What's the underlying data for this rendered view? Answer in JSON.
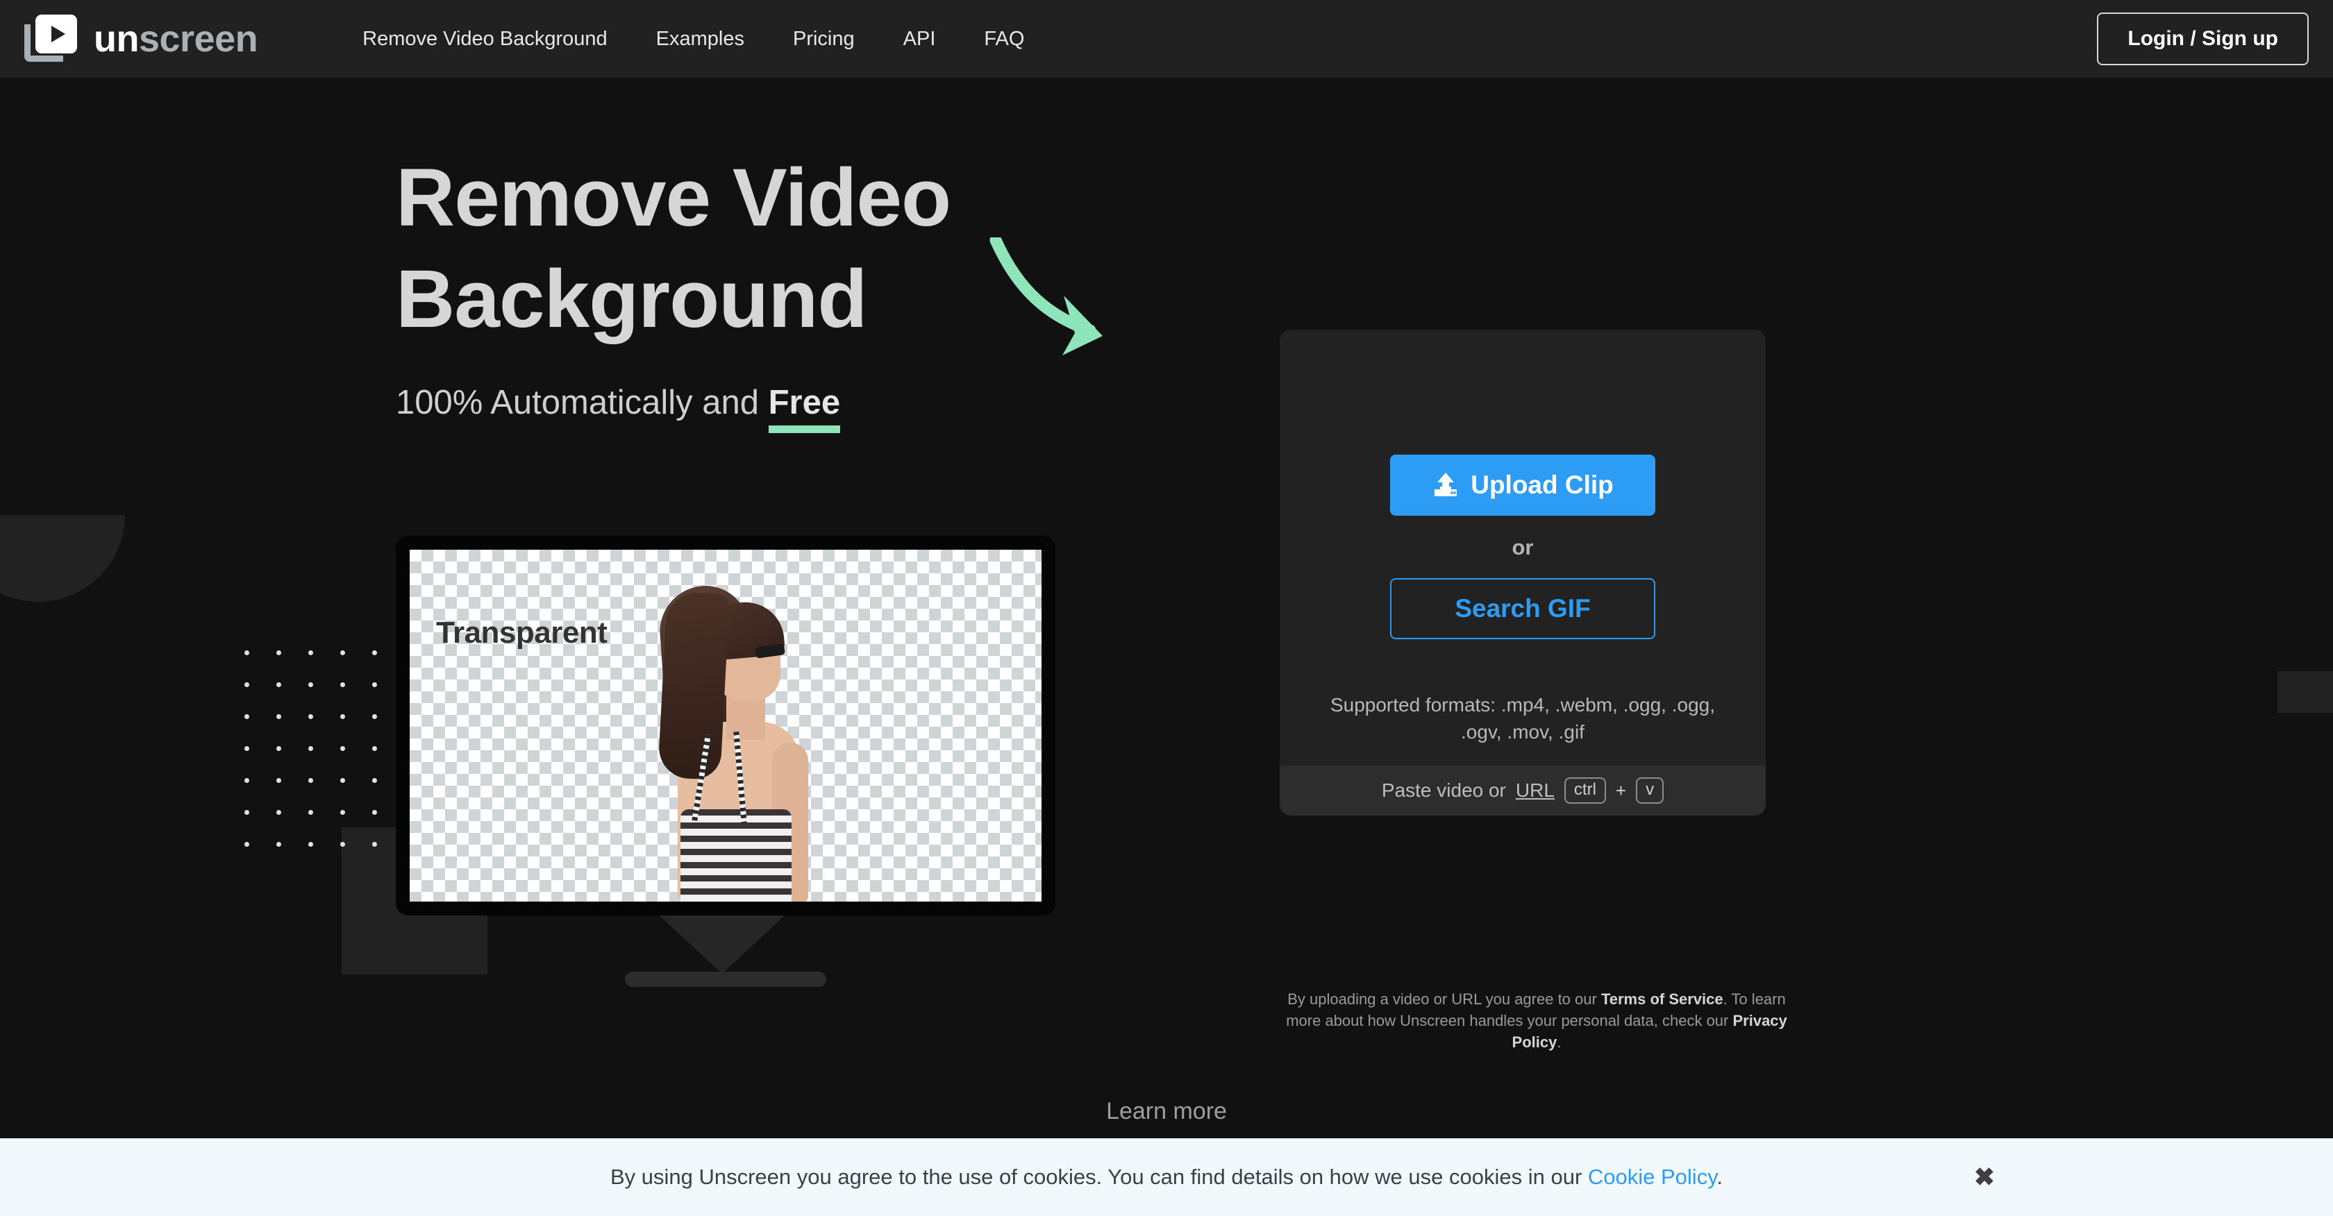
{
  "header": {
    "logo": {
      "un": "un",
      "screen": "screen",
      "icon": "video-stack-play-icon"
    },
    "nav": [
      {
        "label": "Remove Video Background"
      },
      {
        "label": "Examples"
      },
      {
        "label": "Pricing"
      },
      {
        "label": "API"
      },
      {
        "label": "FAQ"
      }
    ],
    "login_label": "Login / Sign up"
  },
  "hero": {
    "title_line1": "Remove Video",
    "title_line2": "Background",
    "subtitle_prefix": "100% Automatically and ",
    "subtitle_highlight": "Free",
    "arrow_color": "#8ee5ba",
    "underline_color": "#8ee5ba"
  },
  "preview": {
    "screen_label": "Transparent",
    "checker_light": "#ffffff",
    "checker_dark": "#cfd4d6"
  },
  "upload_card": {
    "upload_label": "Upload Clip",
    "upload_icon": "upload-icon",
    "or_label": "or",
    "search_gif_label": "Search GIF",
    "formats_text": "Supported formats: .mp4, .webm, .ogg, .ogg, .ogv, .mov, .gif",
    "paste_prefix": "Paste video or ",
    "paste_url_label": "URL",
    "key_ctrl": "ctrl",
    "key_plus": "+",
    "key_v": "v",
    "accent_color": "#2d9cf5"
  },
  "disclaimer": {
    "part1": "By uploading a video or URL you agree to our ",
    "terms_label": "Terms of Service",
    "part2": ". To learn more about how Unscreen handles your personal data, check our ",
    "privacy_label": "Privacy Policy",
    "part3": "."
  },
  "learn_more": {
    "label": "Learn more",
    "icon": "chevron-down-icon"
  },
  "cookie_banner": {
    "text_before": "By using Unscreen you agree to the use of cookies. You can find details on how we use cookies in our ",
    "link_label": "Cookie Policy",
    "text_after": ".",
    "close_icon": "close-icon",
    "close_glyph": "✖",
    "background": "#f2f9fc",
    "link_color": "#2d9cf5"
  }
}
